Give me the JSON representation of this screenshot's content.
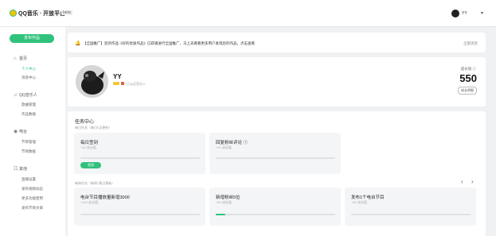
{
  "topbar": {
    "logo_text": "QQ音乐 · 开放平台",
    "logo_sub": "beta",
    "user_name": "YY",
    "caret": "▾"
  },
  "sidebar": {
    "publish_label": "发布作品",
    "groups": [
      {
        "label": "首页",
        "icon": "home-icon",
        "items": [
          {
            "label": "个人中心",
            "active": true
          },
          {
            "label": "消息中心",
            "active": false
          }
        ]
      },
      {
        "label": "QQ音乐人",
        "icon": "musician-icon",
        "items": [
          {
            "label": "歌曲管理",
            "active": false
          },
          {
            "label": "作品数据",
            "active": false
          }
        ]
      },
      {
        "label": "电台",
        "icon": "radio-icon",
        "items": [
          {
            "label": "节目管理",
            "active": false
          },
          {
            "label": "节目数据",
            "active": false
          }
        ]
      },
      {
        "label": "其他",
        "icon": "other-icon",
        "items": [
          {
            "label": "直播设置",
            "active": false
          },
          {
            "label": "发布视频动态",
            "active": false
          },
          {
            "label": "更多功能使用",
            "active": false
          },
          {
            "label": "发布节目文章",
            "active": false
          }
        ]
      }
    ]
  },
  "notice": {
    "text": "【全国推广】您的作品《好的优质作品》已获邀进行全国推广，马上去看看更多用户发现您的作品，点击查看",
    "all_label": "全部消息"
  },
  "profile": {
    "name": "YY",
    "badge_text": "已认证音乐人",
    "growth_label": "成长值",
    "growth_value": "550",
    "growth_btn": "成长明细"
  },
  "tasks": {
    "title": "任务中心",
    "daily_label": "每日任务（每日0点更新）",
    "weekly_label": "每周任务（每周1零点更新）",
    "daily": [
      {
        "name": "每日签到",
        "reward": "+10 成长值",
        "progress": 0,
        "button": "签到"
      },
      {
        "name": "回复粉丝评论 ⓘ",
        "reward": "+10 成长值",
        "progress": 0
      }
    ],
    "weekly": [
      {
        "name": "电台节目播放量新增3000",
        "reward": "+100 成长值",
        "progress": 0
      },
      {
        "name": "新增粉丝5位",
        "reward": "+50 成长值",
        "progress": 0.08
      },
      {
        "name": "发布1个电台节目",
        "reward": "+50 成长值",
        "progress": 0
      }
    ],
    "prev": "‹",
    "next": "›"
  }
}
